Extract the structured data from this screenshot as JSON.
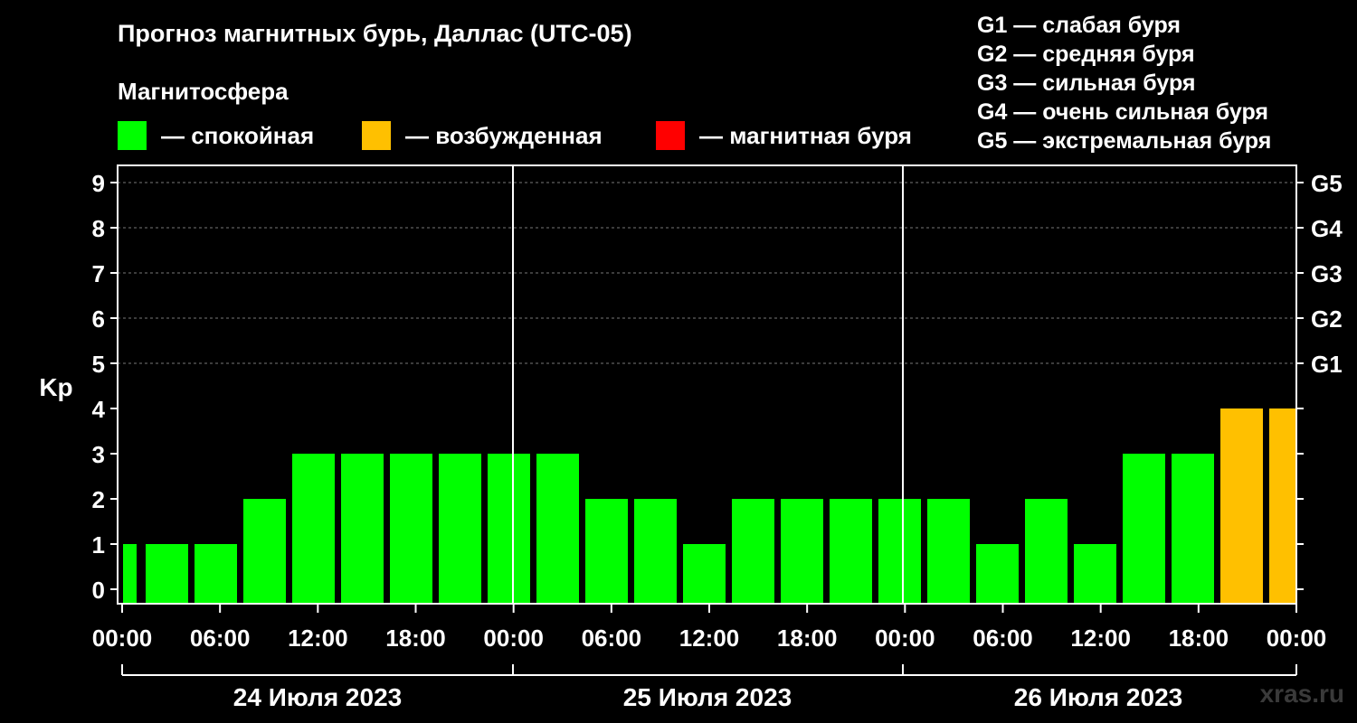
{
  "title": "Прогноз магнитных бурь, Даллас (UTC-05)",
  "subtitle": "Магнитосфера",
  "legend": [
    {
      "label": "— спокойная",
      "color": "#00ff00"
    },
    {
      "label": "— возбужденная",
      "color": "#ffc000"
    },
    {
      "label": "— магнитная буря",
      "color": "#ff0000"
    }
  ],
  "g_scale": [
    {
      "label": "G1 — слабая буря"
    },
    {
      "label": "G2 — средняя буря"
    },
    {
      "label": "G3 — сильная буря"
    },
    {
      "label": "G4 — очень сильная буря"
    },
    {
      "label": "G5 — экстремальная буря"
    }
  ],
  "watermark": "xras.ru",
  "chart_data": {
    "type": "bar",
    "ylabel": "Kp",
    "ylim": [
      0,
      9
    ],
    "y_ticks": [
      "0",
      "1",
      "2",
      "3",
      "4",
      "5",
      "6",
      "7",
      "8",
      "9"
    ],
    "right_ticks": [
      {
        "kp": 5,
        "label": "G1"
      },
      {
        "kp": 6,
        "label": "G2"
      },
      {
        "kp": 7,
        "label": "G3"
      },
      {
        "kp": 8,
        "label": "G4"
      },
      {
        "kp": 9,
        "label": "G5"
      }
    ],
    "x_tick_labels": [
      "00:00",
      "06:00",
      "12:00",
      "18:00",
      "00:00",
      "06:00",
      "12:00",
      "18:00",
      "00:00",
      "06:00",
      "12:00",
      "18:00",
      "00:00"
    ],
    "days": [
      "24 Июля 2023",
      "25 Июля 2023",
      "26 Июля 2023"
    ],
    "grid": "horizontal dashed at Kp 5–9",
    "values": [
      1,
      1,
      1,
      2,
      3,
      3,
      3,
      3,
      3,
      3,
      2,
      2,
      1,
      2,
      2,
      2,
      2,
      2,
      1,
      2,
      1,
      3,
      3,
      4,
      4
    ],
    "colors": [
      "#00ff00",
      "#00ff00",
      "#00ff00",
      "#00ff00",
      "#00ff00",
      "#00ff00",
      "#00ff00",
      "#00ff00",
      "#00ff00",
      "#00ff00",
      "#00ff00",
      "#00ff00",
      "#00ff00",
      "#00ff00",
      "#00ff00",
      "#00ff00",
      "#00ff00",
      "#00ff00",
      "#00ff00",
      "#00ff00",
      "#00ff00",
      "#00ff00",
      "#00ff00",
      "#ffc000",
      "#ffc000"
    ]
  }
}
